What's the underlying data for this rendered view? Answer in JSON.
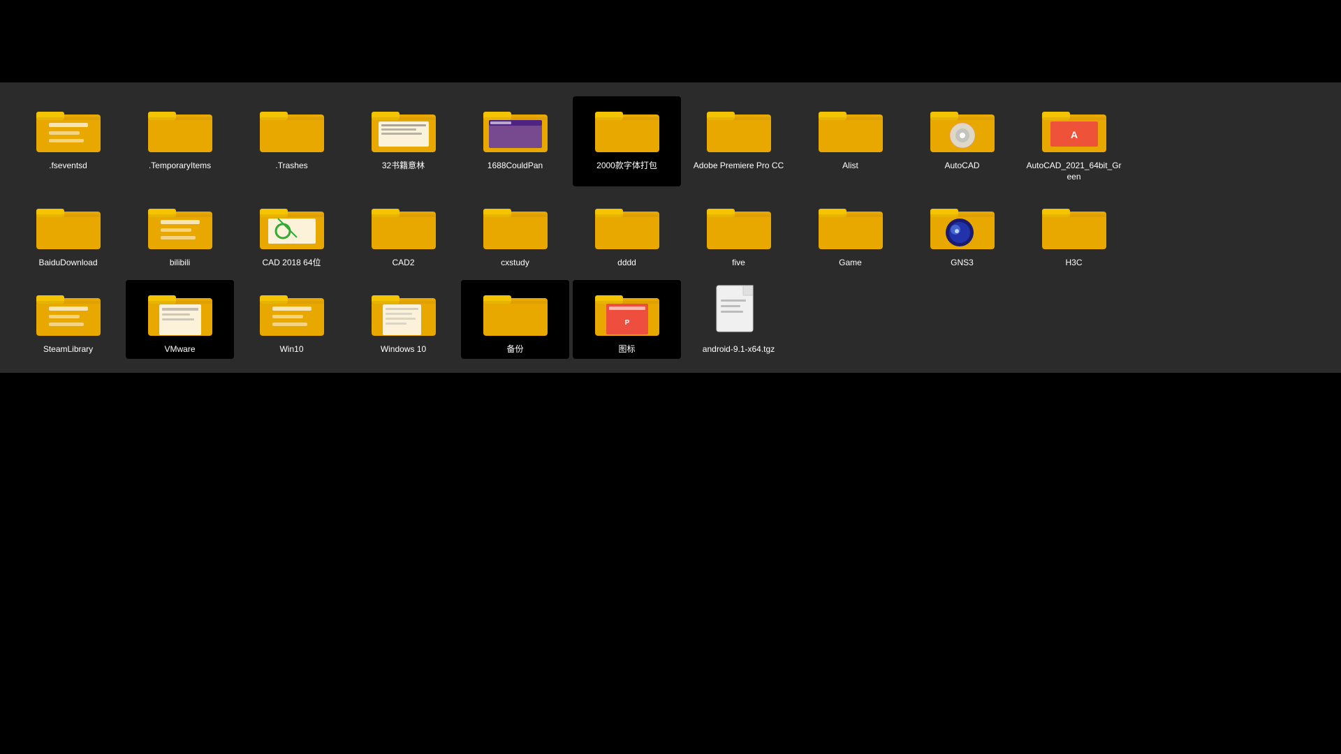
{
  "items": [
    {
      "id": "fseventsd",
      "label": ".fseventsd",
      "type": "folder",
      "variant": "doc",
      "selected": false,
      "row": 1
    },
    {
      "id": "temporaryitems",
      "label": ".TemporaryItems",
      "type": "folder",
      "variant": "plain",
      "selected": false,
      "row": 1
    },
    {
      "id": "trashes",
      "label": ".Trashes",
      "type": "folder",
      "variant": "plain",
      "selected": false,
      "row": 1
    },
    {
      "id": "32books",
      "label": "32书籍意林",
      "type": "folder",
      "variant": "docpreview",
      "selected": false,
      "row": 1
    },
    {
      "id": "1688CouldPan",
      "label": "1688CouldPan",
      "type": "folder",
      "variant": "screenshot",
      "selected": false,
      "row": 1
    },
    {
      "id": "2000fonts",
      "label": "2000款字体打包",
      "type": "folder",
      "variant": "plain",
      "selected": true,
      "row": 1
    },
    {
      "id": "adobepr",
      "label": "Adobe Premiere Pro CC",
      "type": "folder",
      "variant": "plain",
      "selected": false,
      "row": 1
    },
    {
      "id": "alist",
      "label": "Alist",
      "type": "folder",
      "variant": "plain",
      "selected": false,
      "row": 1
    },
    {
      "id": "autocad",
      "label": "AutoCAD",
      "type": "folder",
      "variant": "cdrom",
      "selected": false,
      "row": 1
    },
    {
      "id": "autocad2021",
      "label": "AutoCAD_2021_64bit_Green",
      "type": "folder",
      "variant": "autocad",
      "selected": false,
      "row": 2
    },
    {
      "id": "baidudownload",
      "label": "BaiduDownload",
      "type": "folder",
      "variant": "plain",
      "selected": false,
      "row": 2
    },
    {
      "id": "bilibili",
      "label": "bilibili",
      "type": "folder",
      "variant": "doc",
      "selected": false,
      "row": 2
    },
    {
      "id": "cad2018",
      "label": "CAD 2018 64位",
      "type": "folder",
      "variant": "cad64",
      "selected": false,
      "row": 2
    },
    {
      "id": "cad2",
      "label": "CAD2",
      "type": "folder",
      "variant": "plain",
      "selected": false,
      "row": 2
    },
    {
      "id": "cxstudy",
      "label": "cxstudy",
      "type": "folder",
      "variant": "plain",
      "selected": false,
      "row": 2
    },
    {
      "id": "dddd",
      "label": "dddd",
      "type": "folder",
      "variant": "plain",
      "selected": false,
      "row": 2
    },
    {
      "id": "five",
      "label": "five",
      "type": "folder",
      "variant": "plain",
      "selected": false,
      "row": 2
    },
    {
      "id": "game",
      "label": "Game",
      "type": "folder",
      "variant": "plain2",
      "selected": false,
      "row": 2
    },
    {
      "id": "gns3",
      "label": "GNS3",
      "type": "folder",
      "variant": "gns3",
      "selected": false,
      "row": 3
    },
    {
      "id": "h3c",
      "label": "H3C",
      "type": "folder",
      "variant": "plain",
      "selected": false,
      "row": 3
    },
    {
      "id": "steamlibrary",
      "label": "SteamLibrary",
      "type": "folder",
      "variant": "doc",
      "selected": false,
      "row": 3
    },
    {
      "id": "vmware",
      "label": "VMware",
      "type": "folder",
      "variant": "docbig",
      "selected": true,
      "row": 3
    },
    {
      "id": "win10",
      "label": "Win10",
      "type": "folder",
      "variant": "doc2",
      "selected": false,
      "row": 3
    },
    {
      "id": "windows10",
      "label": "Windows 10",
      "type": "folder",
      "variant": "docpaper",
      "selected": false,
      "row": 3
    },
    {
      "id": "backup",
      "label": "备份",
      "type": "folder",
      "variant": "plain",
      "selected": true,
      "row": 3
    },
    {
      "id": "icons",
      "label": "图标",
      "type": "folder",
      "variant": "ppticon",
      "selected": true,
      "row": 3
    },
    {
      "id": "android",
      "label": "android-9.1-x64.tgz",
      "type": "file",
      "variant": "generic",
      "selected": false,
      "row": 3
    }
  ]
}
